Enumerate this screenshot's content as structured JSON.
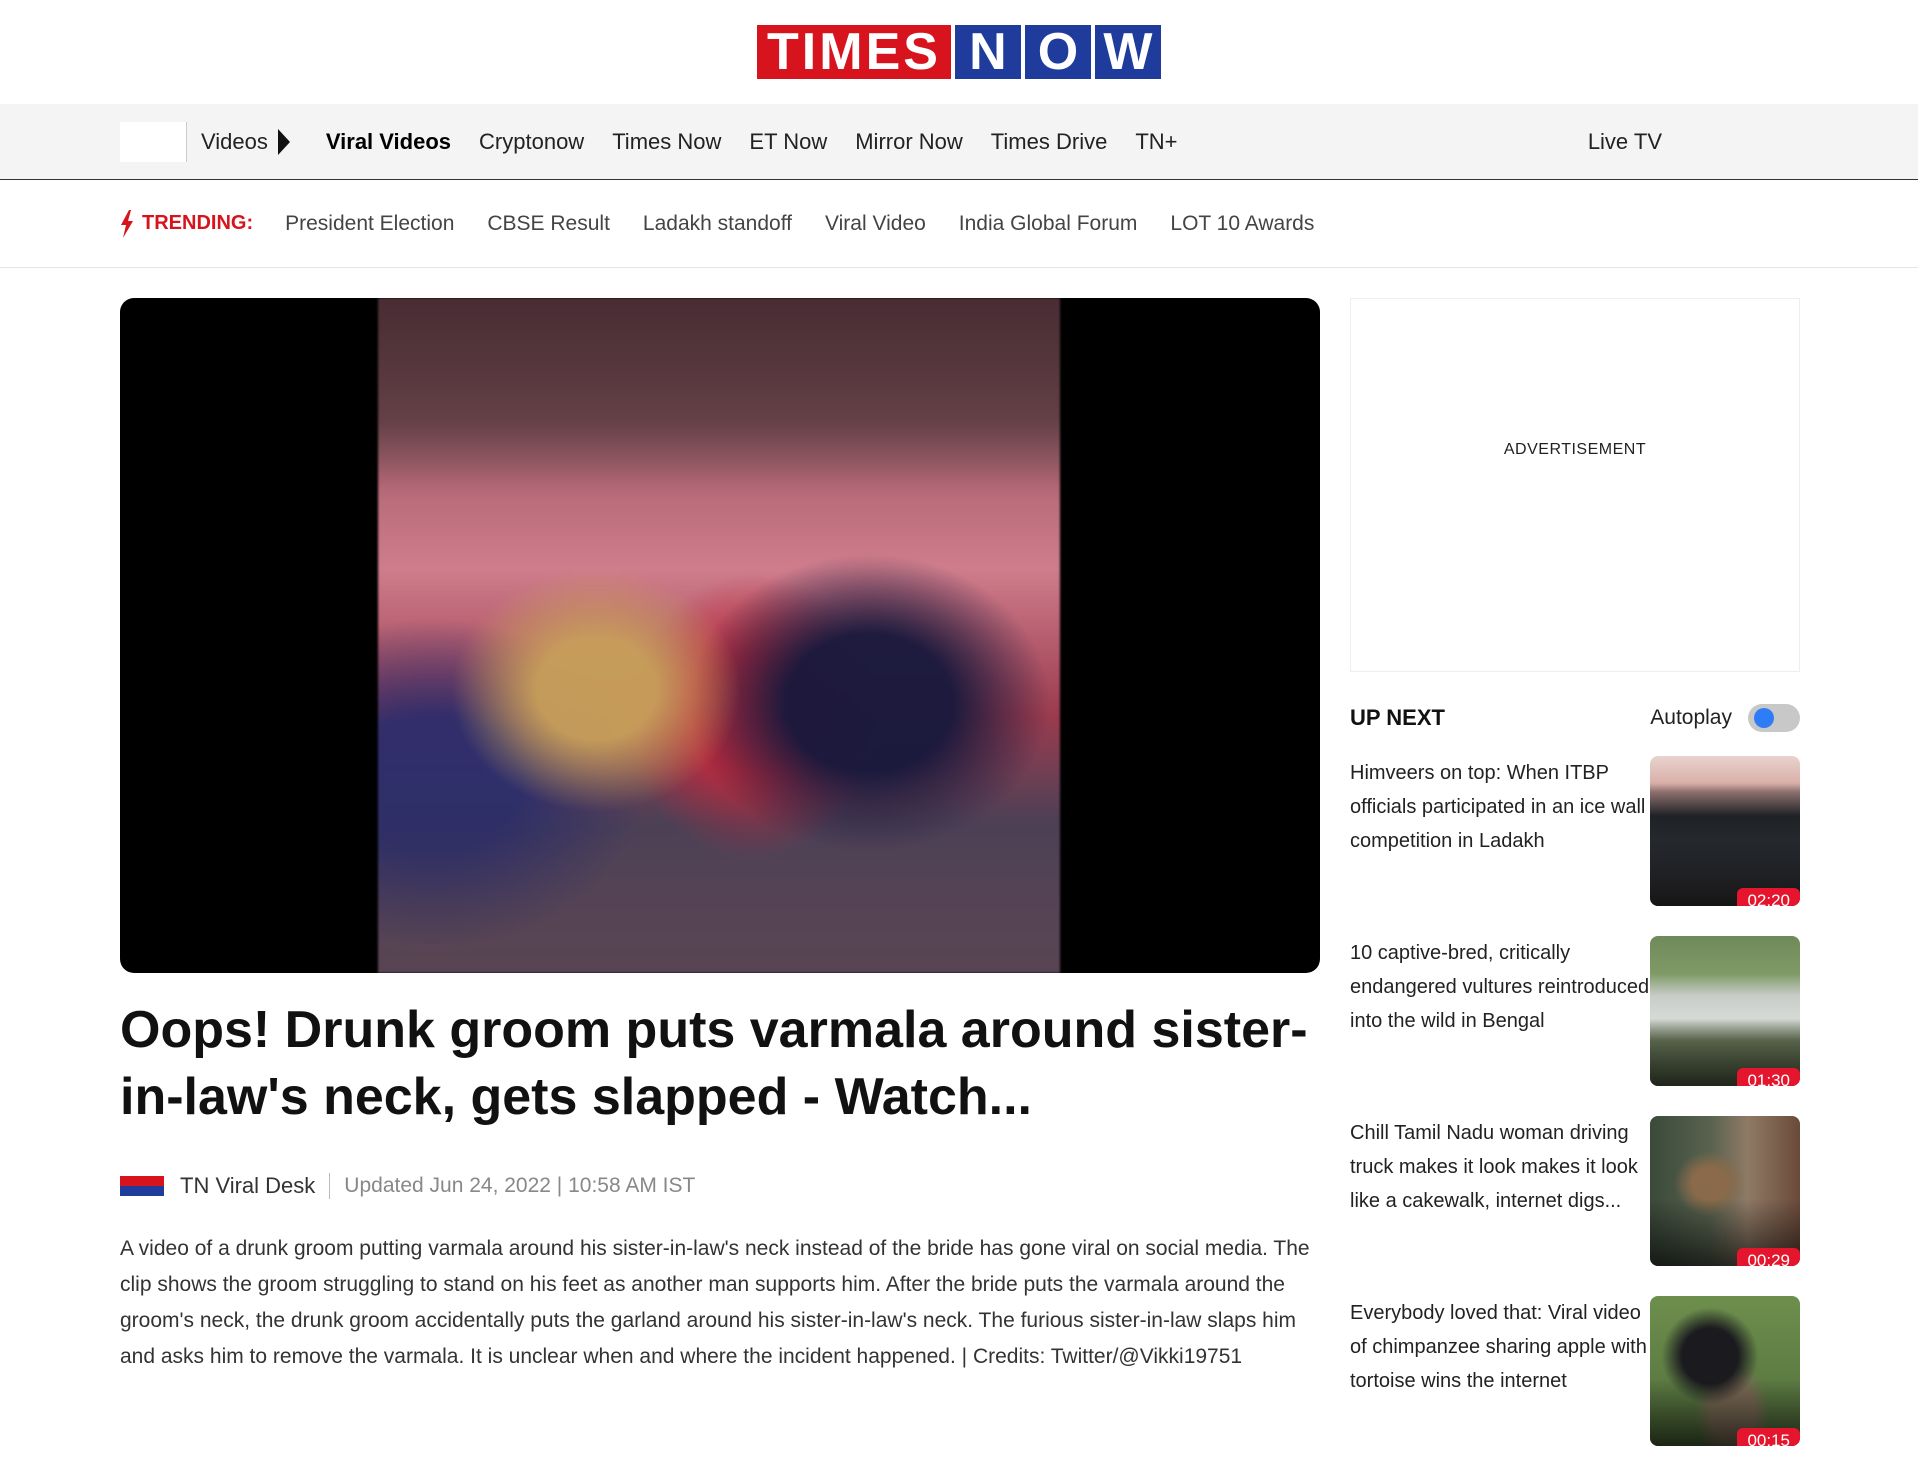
{
  "brand": {
    "logo_times": "TIMES",
    "logo_now": [
      "N",
      "O",
      "W"
    ],
    "red": "#d7141d",
    "blue": "#1f3c9c"
  },
  "nav": {
    "section": "Videos",
    "items": [
      "Viral Videos",
      "Cryptonow",
      "Times Now",
      "ET Now",
      "Mirror Now",
      "Times Drive",
      "TN+"
    ],
    "active": "Viral Videos",
    "live": "Live TV"
  },
  "trending": {
    "label": "TRENDING:",
    "icon": "bolt-icon",
    "items": [
      "President Election",
      "CBSE Result",
      "Ladakh standoff",
      "Viral Video",
      "India Global Forum",
      "LOT 10 Awards"
    ]
  },
  "article": {
    "headline": "Oops! Drunk groom puts varmala around sister-in-law's neck, gets slapped - Watch...",
    "author": "TN Viral Desk",
    "updated": "Updated Jun 24, 2022 | 10:58 AM IST",
    "body": "A video of a drunk groom putting varmala around his sister-in-law's neck instead of the bride has gone viral on social media. The clip shows the groom struggling to stand on his feet as another man supports him. After the bride puts the varmala around the groom's neck, the drunk groom accidentally puts the garland around his sister-in-law's neck. The furious sister-in-law slaps him and asks him to remove the varmala. It is unclear when and where the incident happened. | Credits: Twitter/@Vikki19751"
  },
  "sidebar": {
    "ad_label": "ADVERTISEMENT",
    "up_next_title": "UP NEXT",
    "autoplay_label": "Autoplay",
    "autoplay_on": true,
    "items": [
      {
        "title": "Himveers on top: When ITBP officials participated in an ice wall competition in Ladakh",
        "duration": "02:20"
      },
      {
        "title": "10 captive-bred, critically endangered vultures reintroduced into the wild in Bengal",
        "duration": "01:30"
      },
      {
        "title": "Chill Tamil Nadu woman driving truck makes it look makes it look like a cakewalk, internet digs...",
        "duration": "00:29"
      },
      {
        "title": "Everybody loved that: Viral video of chimpanzee sharing apple with tortoise wins the internet",
        "duration": "00:15"
      }
    ]
  }
}
